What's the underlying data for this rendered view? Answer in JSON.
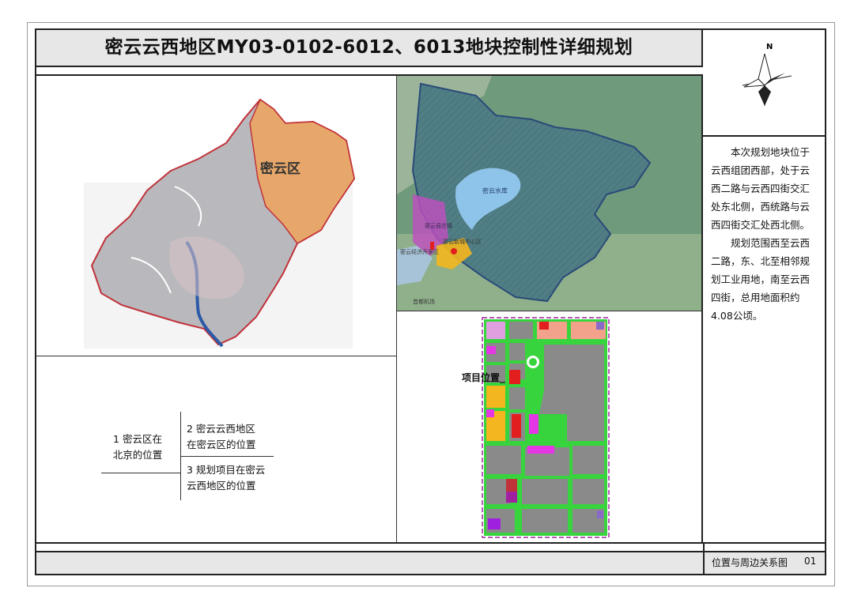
{
  "title": "密云云西地区MY03-0102-6012、6013地块控制性详细规划",
  "north_label": "N",
  "map1": {
    "district_label": "密云区"
  },
  "map2": {
    "reservoir_label": "密云水库",
    "town_label": "密云县庄镇",
    "area_label": "密云经济开发区",
    "center_label": "密云新城中心区",
    "bottom_label": "首都机场"
  },
  "map3": {
    "project_label": "项目位置"
  },
  "legend": {
    "item1_line1": "1 密云区在",
    "item1_line2": "北京的位置",
    "item2_line1": "2 密云云西地区",
    "item2_line2": "在密云区的位置",
    "item3_line1": "3 规划项目在密云",
    "item3_line2": "云西地区的位置"
  },
  "description": {
    "para1": "本次规划地块位于云西组团西部，处于云西二路与云西四街交汇处东北侧，西统路与云西四街交汇处西北侧。",
    "para2": "规划范围西至云西二路，东、北至相邻规划工业用地，南至云西四街，总用地面积约4.08公顷。"
  },
  "footer": {
    "sheet_name": "位置与周边关系图",
    "sheet_number": "01"
  },
  "colors": {
    "district_orange": "#e8a76a",
    "beijing_gray": "#b9b9bd",
    "boundary_red": "#c0323a",
    "reservoir_blue": "#8fc4ea",
    "terrain_green": "#6f9a7c",
    "road_green": "#37d43d",
    "plot_gray": "#8a8a8a",
    "magenta": "#e536e5",
    "red": "#e31e1e",
    "yellow": "#f3b61e"
  }
}
